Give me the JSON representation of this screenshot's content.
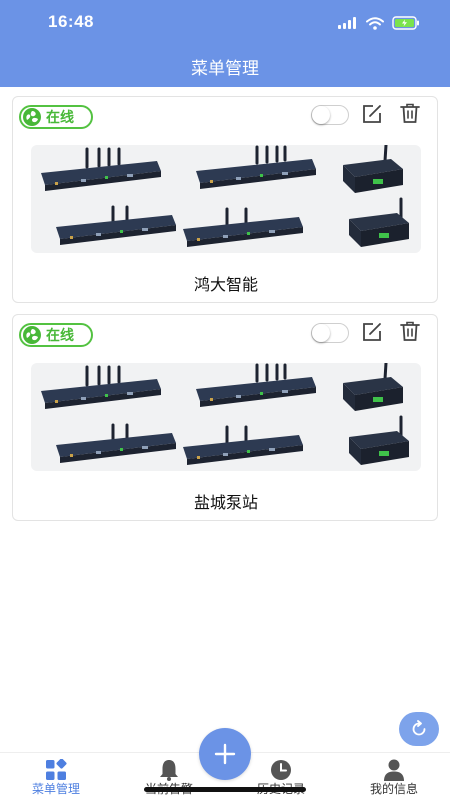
{
  "status_bar": {
    "time": "16:48"
  },
  "header": {
    "title": "菜单管理"
  },
  "colors": {
    "primary": "#6b93e6",
    "online_green": "#53c241",
    "active_tab": "#4e7fe0"
  },
  "devices": [
    {
      "status": "在线",
      "name": "鸿大智能",
      "enabled": false,
      "icons": [
        "edit-icon",
        "trash-icon"
      ]
    },
    {
      "status": "在线",
      "name": "盐城泵站",
      "enabled": false,
      "icons": [
        "edit-icon",
        "trash-icon"
      ]
    }
  ],
  "floating": {
    "refresh_icon": "refresh-icon",
    "add_icon": "plus-icon"
  },
  "tabs": [
    {
      "label": "菜单管理",
      "icon": "grid-icon",
      "active": true
    },
    {
      "label": "当前告警",
      "icon": "bell-icon",
      "active": false
    },
    {
      "label": "历史记录",
      "icon": "clock-icon",
      "active": false
    },
    {
      "label": "我的信息",
      "icon": "user-icon",
      "active": false
    }
  ]
}
